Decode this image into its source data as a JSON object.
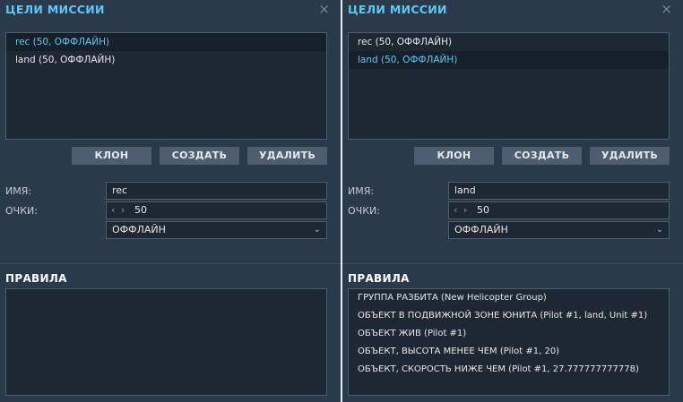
{
  "left": {
    "title": "ЦЕЛИ МИССИИ",
    "close_glyph": "×",
    "goals": [
      {
        "label": "rec (50, ОФФЛАЙН)",
        "selected": true
      },
      {
        "label": "land (50, ОФФЛАЙН)",
        "selected": false
      }
    ],
    "buttons": {
      "clone": "КЛОН",
      "create": "СОЗДАТЬ",
      "delete": "УДАЛИТЬ"
    },
    "name_label": "ИМЯ:",
    "name_value": "rec",
    "points_label": "ОЧКИ:",
    "points_value": "50",
    "status_value": "ОФФЛАЙН",
    "rules_title": "ПРАВИЛА",
    "rules": []
  },
  "right": {
    "title": "ЦЕЛИ МИССИИ",
    "close_glyph": "×",
    "goals": [
      {
        "label": "rec (50, ОФФЛАЙН)",
        "selected": false
      },
      {
        "label": "land (50, ОФФЛАЙН)",
        "selected": true
      }
    ],
    "buttons": {
      "clone": "КЛОН",
      "create": "СОЗДАТЬ",
      "delete": "УДАЛИТЬ"
    },
    "name_label": "ИМЯ:",
    "name_value": "land",
    "points_label": "ОЧКИ:",
    "points_value": "50",
    "status_value": "ОФФЛАЙН",
    "rules_title": "ПРАВИЛА",
    "rules": [
      "ГРУППА РАЗБИТА (New Helicopter Group)",
      "ОБЪЕКТ В ПОДВИЖНОЙ ЗОНЕ ЮНИТА (Pilot #1, land, Unit #1)",
      "ОБЪЕКТ ЖИВ (Pilot #1)",
      "ОБЪЕКТ, ВЫСОТА МЕНЕЕ ЧЕМ (Pilot #1, 20)",
      "ОБЪЕКТ, СКОРОСТЬ НИЖЕ ЧЕМ (Pilot #1, 27.777777777778)"
    ]
  },
  "icons": {
    "stepper_left": "‹",
    "stepper_right": "›",
    "dropdown": "⌄"
  },
  "colors": {
    "accent": "#5ec8f2",
    "panel_bg": "#2b3a4a",
    "list_bg": "#1e2833",
    "button_bg": "#4e5e70"
  }
}
